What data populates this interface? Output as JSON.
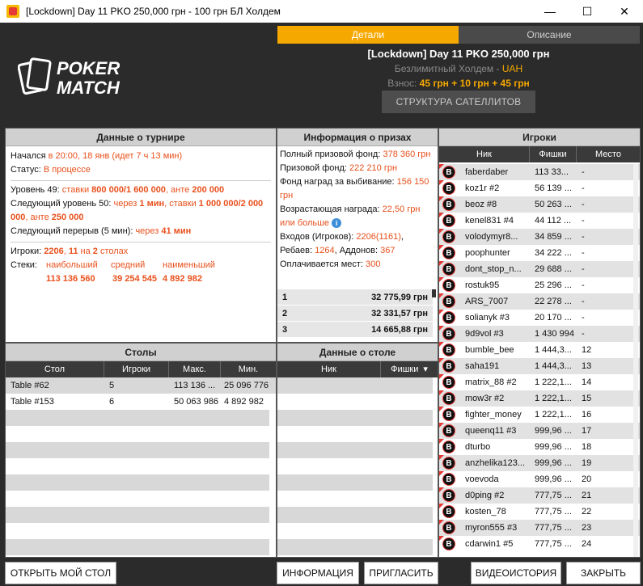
{
  "window": {
    "title": "[Lockdown] Day 11 PKO 250,000 грн - 100 грн БЛ Холдем",
    "minimize": "—",
    "maximize": "☐",
    "close": "✕"
  },
  "logo": {
    "line1": "POKER",
    "line2": "MATCH"
  },
  "tabs": {
    "details": "Детали",
    "description": "Описание"
  },
  "tournament": {
    "name": "[Lockdown] Day 11 PKO 250,000 грн",
    "game_type": "Безлимитный Холдем - ",
    "currency": "UAH",
    "fee_label": "Взнос: ",
    "fee_value": "45 грн + 10 грн + 45 грн",
    "satellite_button": "СТРУКТУРА САТЕЛЛИТОВ"
  },
  "tourney_panel": {
    "title": "Данные о турнире",
    "started_label": "Начался ",
    "started_value": "в 20:00, 18 янв (идет 7 ч 13 мин)",
    "status_label": "Статус: ",
    "status_value": "В процессе",
    "level_label": "Уровень 49: ",
    "level_stakes_pre": "ставки ",
    "level_stakes": "800 000/1 600 000",
    "level_ante_pre": ", анте ",
    "level_ante": "200 000",
    "next_level_label": "Следующий уровень 50: ",
    "next_level_in_pre": "через ",
    "next_level_in": "1 мин",
    "next_level_stakes_pre": ", ставки ",
    "next_level_stakes": "1 000 000/2 000 000",
    "next_level_ante_pre": ", анте ",
    "next_level_ante": "250 000",
    "next_break_label": "Следующий перерыв (5 мин): ",
    "next_break_pre": "через ",
    "next_break": "41 мин",
    "players_label": "Игроки: ",
    "players_count": "2206",
    "players_sep": ", ",
    "players_tables": "11",
    "players_on": " на ",
    "players_tables_count": "2",
    "players_tables_word": " столах",
    "stacks_label": "Стеки:",
    "stack_largest_label": "наибольший",
    "stack_avg_label": "средний",
    "stack_smallest_label": "наименьший",
    "stack_largest": "113 136 560",
    "stack_avg": "39 254 545",
    "stack_smallest": "4 892 982"
  },
  "prize_panel": {
    "title": "Информация о призах",
    "total_label": "Полный призовой фонд: ",
    "total_value": "378 360 грн",
    "prize_label": "Призовой фонд: ",
    "prize_value": "222 210 грн",
    "ko_label": "Фонд наград за выбивание: ",
    "ko_value": "156 150 грн",
    "progressive_label": "Возрастающая награда: ",
    "progressive_value": "22,50 грн или больше",
    "info_glyph": "i",
    "entries_label": "Входов (Игроков): ",
    "entries_value": "2206(1161)",
    "rebuys_label": "Ребаев: ",
    "rebuys_value": "1264",
    "addons_label": ", Аддонов: ",
    "addons_value": "367",
    "paid_label": "Оплачивается мест: ",
    "paid_value": "300",
    "payouts": [
      {
        "pos": "1",
        "amount": "32 775,99 грн"
      },
      {
        "pos": "2",
        "amount": "32 331,57 грн"
      },
      {
        "pos": "3",
        "amount": "14 665,88 грн"
      }
    ]
  },
  "players_panel": {
    "title": "Игроки",
    "col_nick": "Ник",
    "col_chips": "Фишки",
    "col_place": "Место",
    "badge_letter": "B",
    "rows": [
      {
        "nick": "faberdaber",
        "chips": "113 33...",
        "place": "-"
      },
      {
        "nick": "koz1r #2",
        "chips": "56 139 ...",
        "place": "-"
      },
      {
        "nick": "beoz #8",
        "chips": "50 263 ...",
        "place": "-"
      },
      {
        "nick": "kenel831 #4",
        "chips": "44 112 ...",
        "place": "-"
      },
      {
        "nick": "volodymyr8...",
        "chips": "34 859 ...",
        "place": "-"
      },
      {
        "nick": "poophunter",
        "chips": "34 222 ...",
        "place": "-"
      },
      {
        "nick": "dont_stop_n...",
        "chips": "29 688 ...",
        "place": "-"
      },
      {
        "nick": "rostuk95",
        "chips": "25 296 ...",
        "place": "-"
      },
      {
        "nick": "ARS_7007",
        "chips": "22 278 ...",
        "place": "-"
      },
      {
        "nick": "solianyk #3",
        "chips": "20 170 ...",
        "place": "-"
      },
      {
        "nick": "9d9vol #3",
        "chips": "1 430 994",
        "place": "-"
      },
      {
        "nick": "bumble_bee",
        "chips": "1 444,3...",
        "place": "12"
      },
      {
        "nick": "saha191",
        "chips": "1 444,3...",
        "place": "13"
      },
      {
        "nick": "matrix_88 #2",
        "chips": "1 222,1...",
        "place": "14"
      },
      {
        "nick": "mow3r #2",
        "chips": "1 222,1...",
        "place": "15"
      },
      {
        "nick": "fighter_money",
        "chips": "1 222,1...",
        "place": "16"
      },
      {
        "nick": "queenq11 #3",
        "chips": "999,96 ...",
        "place": "17"
      },
      {
        "nick": "dturbo",
        "chips": "999,96 ...",
        "place": "18"
      },
      {
        "nick": "anzhelika123...",
        "chips": "999,96 ...",
        "place": "19"
      },
      {
        "nick": "voevoda",
        "chips": "999,96 ...",
        "place": "20"
      },
      {
        "nick": "d0ping #2",
        "chips": "777,75 ...",
        "place": "21"
      },
      {
        "nick": "kosten_78",
        "chips": "777,75 ...",
        "place": "22"
      },
      {
        "nick": "myron555 #3",
        "chips": "777,75 ...",
        "place": "23"
      },
      {
        "nick": "cdarwin1 #5",
        "chips": "777,75 ...",
        "place": "24"
      }
    ]
  },
  "tables_panel": {
    "title": "Столы",
    "col_table": "Стол",
    "col_players": "Игроки",
    "col_max": "Макс.",
    "col_min": "Мин.",
    "rows": [
      {
        "table": "Table #62",
        "players": "5",
        "max": "113 136 ...",
        "min": "25 096 776"
      },
      {
        "table": "Table #153",
        "players": "6",
        "max": "50 063 986",
        "min": "4 892 982"
      }
    ]
  },
  "table_data_panel": {
    "title": "Данные о столе",
    "col_nick": "Ник",
    "col_chips": "Фишки",
    "sort_glyph": "▾"
  },
  "buttons": {
    "open_table": "ОТКРЫТЬ МОЙ СТОЛ",
    "info": "ИНФОРМАЦИЯ",
    "invite": "ПРИГЛАСИТЬ",
    "video": "ВИДЕОИСТОРИЯ",
    "close": "ЗАКРЫТЬ"
  },
  "colors": {
    "accent": "#f5a800",
    "highlight": "#e8501c",
    "header_bg": "#2b2b2b"
  }
}
